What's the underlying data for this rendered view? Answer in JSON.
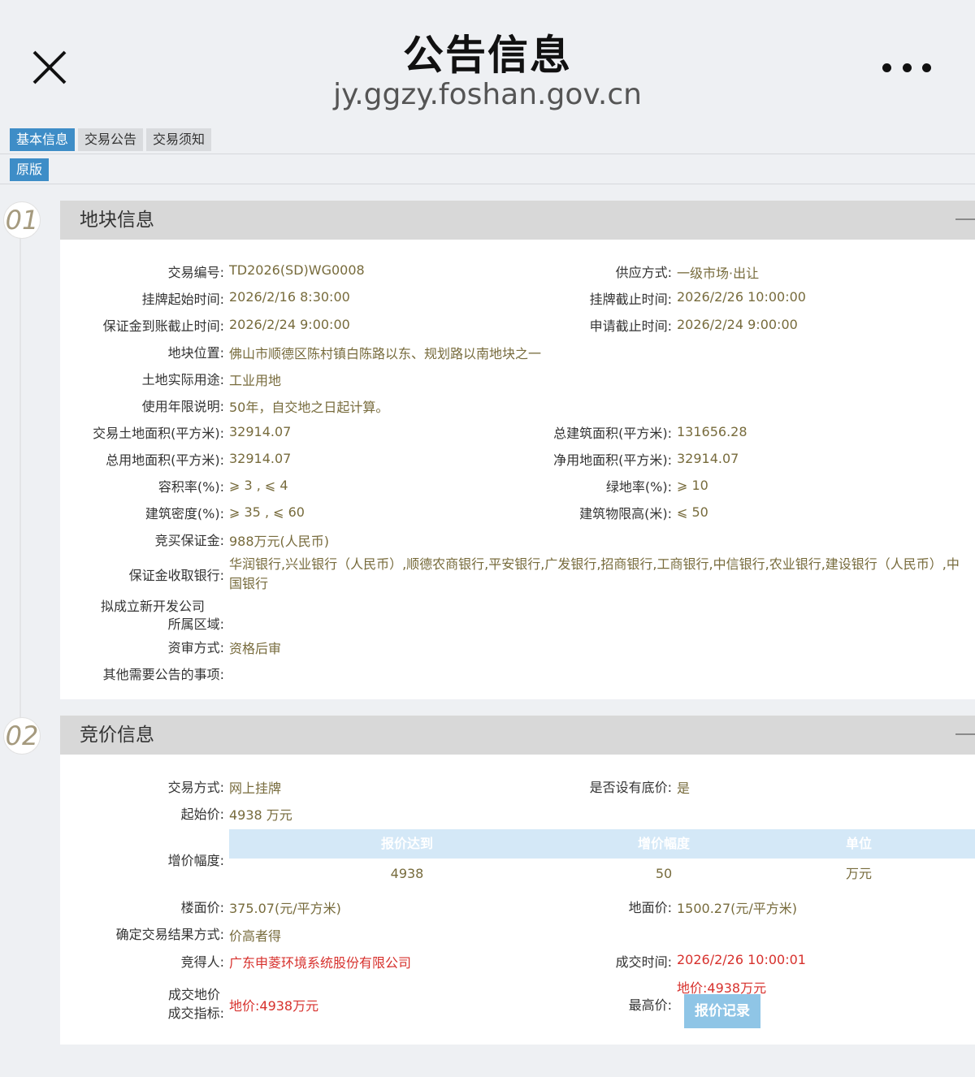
{
  "header": {
    "title": "公告信息",
    "url": "jy.ggzy.foshan.gov.cn"
  },
  "tabs": [
    {
      "label": "基本信息",
      "active": true
    },
    {
      "label": "交易公告",
      "active": false
    },
    {
      "label": "交易须知",
      "active": false
    }
  ],
  "original_button": "原版",
  "colors": {
    "accent_blue": "#3e8dc7",
    "value_text": "#776b3c",
    "highlight_red": "#d7312d",
    "section_header_bg": "#d8d8d8"
  },
  "section1": {
    "number": "01",
    "title": "地块信息",
    "fields": {
      "trade_no_label": "交易编号:",
      "trade_no": "TD2026(SD)WG0008",
      "supply_label": "供应方式:",
      "supply": "一级市场·出让",
      "list_start_label": "挂牌起始时间:",
      "list_start": "2026/2/16 8:30:00",
      "list_end_label": "挂牌截止时间:",
      "list_end": "2026/2/26 10:00:00",
      "deposit_deadline_label": "保证金到账截止时间:",
      "deposit_deadline": "2026/2/24 9:00:00",
      "apply_deadline_label": "申请截止时间:",
      "apply_deadline": "2026/2/24 9:00:00",
      "location_label": "地块位置:",
      "location": "佛山市顺德区陈村镇白陈路以东、规划路以南地块之一",
      "usage_label": "土地实际用途:",
      "usage": "工业用地",
      "term_label": "使用年限说明:",
      "term": "50年，自交地之日起计算。",
      "trade_area_label": "交易土地面积(平方米):",
      "trade_area": "32914.07",
      "total_build_area_label": "总建筑面积(平方米):",
      "total_build_area": "131656.28",
      "total_land_area_label": "总用地面积(平方米):",
      "total_land_area": "32914.07",
      "net_land_area_label": "净用地面积(平方米):",
      "net_land_area": "32914.07",
      "plot_ratio_label": "容积率(%):",
      "plot_ratio": "⩾ 3 , ⩽ 4",
      "green_ratio_label": "绿地率(%):",
      "green_ratio": "⩾ 10",
      "density_label": "建筑密度(%):",
      "density": "⩾ 35 , ⩽ 60",
      "height_label": "建筑物限高(米):",
      "height": "⩽ 50",
      "bid_deposit_label": "竞买保证金:",
      "bid_deposit": "988万元(人民币)",
      "banks_label": "保证金收取银行:",
      "banks": "华润银行,兴业银行（人民币）,顺德农商银行,平安银行,广发银行,招商银行,工商银行,中信银行,农业银行,建设银行（人民币）,中国银行",
      "new_company_label_line1": "拟成立新开发公司",
      "new_company_label_line2": "所属区域:",
      "qualification_label": "资审方式:",
      "qualification": "资格后审",
      "other_label": "其他需要公告的事项:"
    }
  },
  "section2": {
    "number": "02",
    "title": "竞价信息",
    "fields": {
      "method_label": "交易方式:",
      "method": "网上挂牌",
      "reserve_label": "是否设有底价:",
      "reserve": "是",
      "start_price_label": "起始价:",
      "start_price": "4938 万元",
      "increment_label": "增价幅度:",
      "floor_price_label": "楼面价:",
      "floor_price": "375.07(元/平方米)",
      "land_price_label": "地面价:",
      "land_price": "1500.27(元/平方米)",
      "result_method_label": "确定交易结果方式:",
      "result_method": "价高者得",
      "winner_label": "竞得人:",
      "winner": "广东申菱环境系统股份有限公司",
      "deal_time_label": "成交时间:",
      "deal_time": "2026/2/26 10:00:01",
      "deal_index_label_line1": "成交地价",
      "deal_index_label_line2": "成交指标:",
      "deal_index": "地价:4938万元",
      "highest_label": "最高价:",
      "highest": "地价:4938万元",
      "bid_record_button": "报价记录"
    },
    "increment_table": {
      "headers": [
        "报价达到",
        "增价幅度",
        "单位"
      ],
      "rows": [
        [
          "4938",
          "50",
          "万元"
        ]
      ]
    }
  }
}
